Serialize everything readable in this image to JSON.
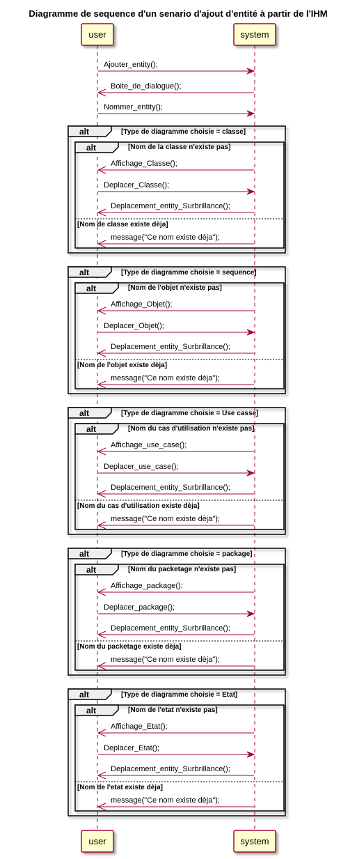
{
  "title": "Diagramme de sequence d'un senario d'ajout d'entité à partir de l'IHM",
  "colors": {
    "participant_fill": "#FEFECE",
    "participant_border": "#A80036",
    "arrow": "#A80036"
  },
  "participants": [
    "user",
    "system"
  ],
  "initial_messages": [
    {
      "text": "Ajouter_entity();",
      "dir": "right"
    },
    {
      "text": "Boite_de_dialogue();",
      "dir": "left"
    },
    {
      "text": "Nommer_entity();",
      "dir": "right"
    }
  ],
  "alt_label": "alt",
  "groups": [
    {
      "guard": "[Type de diagramme choisie = classe]",
      "inner_guard": "[Nom de la classe n'existe pas]",
      "messages": [
        {
          "text": "Affichage_Classe();",
          "dir": "left"
        },
        {
          "text": "Deplacer_Classe();",
          "dir": "right"
        },
        {
          "text": "Deplacement_entity_Surbrillance();",
          "dir": "left"
        }
      ],
      "else_guard": "[Nom de classe existe dèja]",
      "else_message": "message(\"Ce nom existe dèja\");"
    },
    {
      "guard": "[Type de diagramme choisie = sequence]",
      "inner_guard": "[Nom de l'objet n'existe pas]",
      "messages": [
        {
          "text": "Affichage_Objet();",
          "dir": "left"
        },
        {
          "text": "Deplacer_Objet();",
          "dir": "right"
        },
        {
          "text": "Deplacement_entity_Surbrillance();",
          "dir": "left"
        }
      ],
      "else_guard": "[Nom de l'objet existe dèja]",
      "else_message": "message(\"Ce nom existe dèja\");"
    },
    {
      "guard": "[Type de diagramme choisie = Use casse]",
      "inner_guard": "[Nom du cas d'utilisation n'existe pas]",
      "messages": [
        {
          "text": "Affichage_use_case();",
          "dir": "left"
        },
        {
          "text": "Deplacer_use_case();",
          "dir": "right"
        },
        {
          "text": "Deplacement_entity_Surbrillance();",
          "dir": "left"
        }
      ],
      "else_guard": "[Nom du cas d'utilisation existe dèja]",
      "else_message": "message(\"Ce nom existe dèja\");"
    },
    {
      "guard": "[Type de diagramme choisie = package]",
      "inner_guard": "[Nom du packetage n'existe pas]",
      "messages": [
        {
          "text": "Affichage_package();",
          "dir": "left"
        },
        {
          "text": "Deplacer_package();",
          "dir": "right"
        },
        {
          "text": "Deplacement_entity_Surbrillance();",
          "dir": "left"
        }
      ],
      "else_guard": "[Nom du packetage existe dèja]",
      "else_message": "message(\"Ce nom existe dèja\");"
    },
    {
      "guard": "[Type de diagramme choisie = Etat]",
      "inner_guard": "[Nom de l'etat n'existe pas]",
      "messages": [
        {
          "text": "Affichage_Etat();",
          "dir": "left"
        },
        {
          "text": "Deplacer_Etat();",
          "dir": "right"
        },
        {
          "text": "Deplacement_entity_Surbrillance();",
          "dir": "left"
        }
      ],
      "else_guard": "[Nom de l'etat existe dèja]",
      "else_message": "message(\"Ce nom existe dèja\");"
    }
  ]
}
